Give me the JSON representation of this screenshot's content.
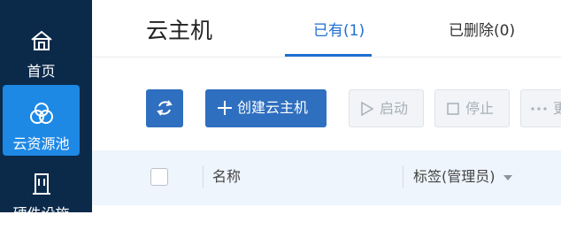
{
  "sidebar": {
    "items": [
      {
        "label": "首页",
        "icon": "home-icon"
      },
      {
        "label": "云资源池",
        "icon": "cloud-resource-pool-icon",
        "active": true
      },
      {
        "label": "硬件设施",
        "icon": "hardware-icon"
      }
    ]
  },
  "header": {
    "title": "云主机",
    "tabs": [
      {
        "label": "已有(1)",
        "active": true
      },
      {
        "label": "已删除(0)"
      }
    ]
  },
  "toolbar": {
    "refresh_icon": "refresh-icon",
    "create_label": "创建云主机",
    "start_label": "启动",
    "stop_label": "停止",
    "more_label": "更"
  },
  "table": {
    "columns": [
      "名称",
      "标签(管理员)"
    ]
  },
  "colors": {
    "sidebar_bg": "#0b2a4a",
    "sidebar_active": "#1e88e5",
    "primary": "#2f6fbf",
    "tab_active": "#1f6fd0",
    "table_header_bg": "#eef5fc"
  }
}
